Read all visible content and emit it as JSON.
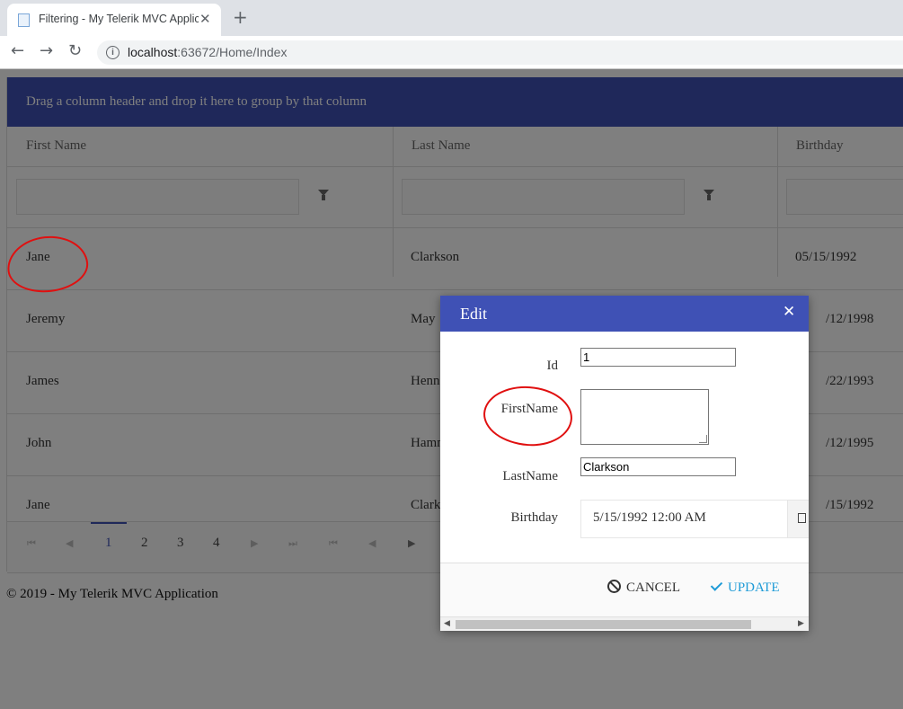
{
  "browser": {
    "tab_title": "Filtering - My Telerik MVC Applic",
    "tab_close": "✕",
    "new_tab": "+",
    "url_host": "localhost",
    "url_rest": ":63672/Home/Index",
    "back": "←",
    "forward": "→",
    "reload": "↻",
    "info": "i"
  },
  "grid": {
    "group_panel_text": "Drag a column header and drop it here to group by that column",
    "columns": [
      "First Name",
      "Last Name",
      "Birthday"
    ],
    "rows": [
      {
        "first": "Jane",
        "last": "Clarkson",
        "birthday": "05/15/1992"
      },
      {
        "first": "Jeremy",
        "last": "May",
        "birthday": "/12/1998"
      },
      {
        "first": "James",
        "last": "Henn",
        "birthday": "/22/1993"
      },
      {
        "first": "John",
        "last": "Hamm",
        "birthday": "/12/1995"
      },
      {
        "first": "Jane",
        "last": "Clark",
        "birthday": "/15/1992"
      }
    ],
    "pager": {
      "first": "⏮",
      "prev": "◀",
      "pages": [
        "1",
        "2",
        "3",
        "4"
      ],
      "active_page": "1",
      "next": "▶",
      "last": "⏭",
      "extra_first": "⏮",
      "extra_prev": "◀",
      "extra_next": "▶"
    }
  },
  "footer": "© 2019 - My Telerik MVC Application",
  "dialog": {
    "title": "Edit",
    "close": "✕",
    "fields": {
      "id_label": "Id",
      "id_value": "1",
      "firstname_label": "FirstName",
      "firstname_value": "",
      "lastname_label": "LastName",
      "lastname_value": "Clarkson",
      "birthday_label": "Birthday",
      "birthday_value": "5/15/1992 12:00 AM"
    },
    "cancel_label": "CANCEL",
    "update_label": "UPDATE",
    "scroll_left": "◀",
    "scroll_right": "▶"
  },
  "colors": {
    "accent": "#3f51b5",
    "update": "#1e9bd7",
    "annotation": "#e01010"
  }
}
